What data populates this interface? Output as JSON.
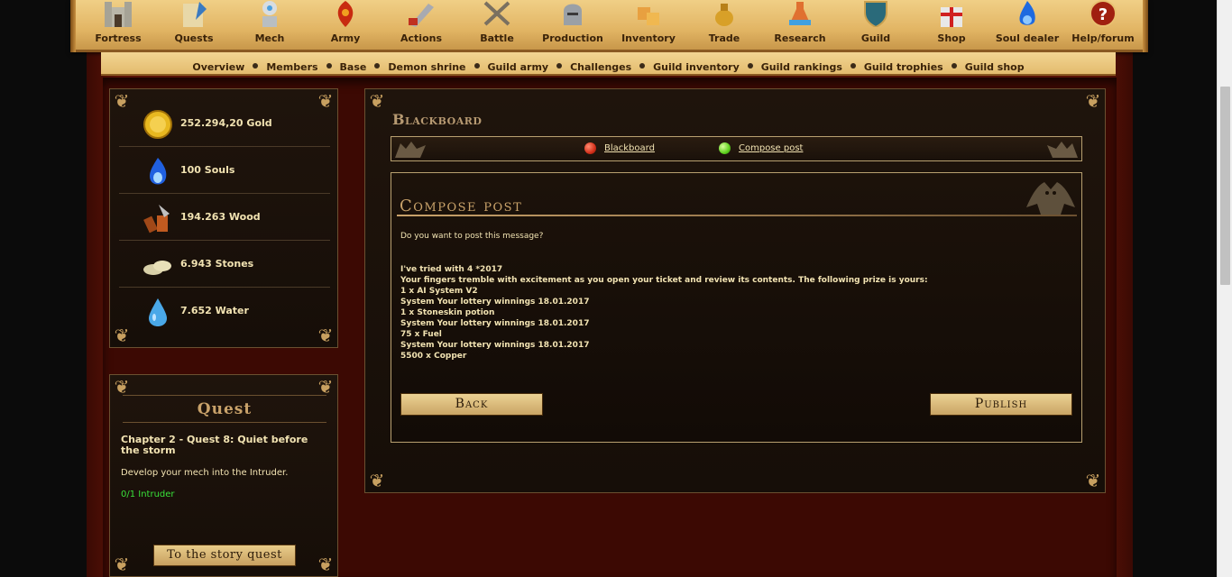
{
  "nav": {
    "items": [
      {
        "label": "Fortress",
        "icon": "fortress-icon"
      },
      {
        "label": "Quests",
        "icon": "quests-icon"
      },
      {
        "label": "Mech",
        "icon": "mech-icon"
      },
      {
        "label": "Army",
        "icon": "army-icon"
      },
      {
        "label": "Actions",
        "icon": "actions-icon"
      },
      {
        "label": "Battle",
        "icon": "battle-icon"
      },
      {
        "label": "Production",
        "icon": "production-icon"
      },
      {
        "label": "Inventory",
        "icon": "inventory-icon"
      },
      {
        "label": "Trade",
        "icon": "trade-icon"
      },
      {
        "label": "Research",
        "icon": "research-icon"
      },
      {
        "label": "Guild",
        "icon": "guild-icon"
      },
      {
        "label": "Shop",
        "icon": "shop-icon"
      },
      {
        "label": "Soul dealer",
        "icon": "soul-dealer-icon"
      },
      {
        "label": "Help/forum",
        "icon": "help-icon"
      }
    ]
  },
  "subnav": {
    "items": [
      "Overview",
      "Members",
      "Base",
      "Demon shrine",
      "Guild army",
      "Challenges",
      "Guild inventory",
      "Guild rankings",
      "Guild trophies",
      "Guild shop"
    ]
  },
  "resources": [
    {
      "label": "252.294,20 Gold",
      "icon": "gold-icon"
    },
    {
      "label": "100 Souls",
      "icon": "souls-icon"
    },
    {
      "label": "194.263 Wood",
      "icon": "wood-icon"
    },
    {
      "label": "6.943 Stones",
      "icon": "stones-icon"
    },
    {
      "label": "7.652 Water",
      "icon": "water-icon"
    }
  ],
  "quest": {
    "title": "Quest",
    "chapter": "Chapter 2 - Quest 8: Quiet before the storm",
    "description": "Develop your mech into the Intruder.",
    "progress": "0/1 Intruder",
    "button": "To the story quest"
  },
  "main": {
    "title": "Blackboard",
    "tabs": [
      {
        "label": "Blackboard",
        "orb_color": "#d3301a"
      },
      {
        "label": "Compose post",
        "orb_color": "#5fd21e"
      }
    ],
    "compose": {
      "title": "Compose post",
      "question": "Do you want to post this message?",
      "message_lines": [
        "I've tried with 4 *2017",
        "Your fingers tremble with excitement as you open your ticket and review its contents. The following prize is yours:",
        "1 x AI System V2",
        "System Your lottery winnings 18.01.2017",
        "1 x Stoneskin potion",
        "System Your lottery winnings 18.01.2017",
        "75 x Fuel",
        "System Your lottery winnings 18.01.2017",
        "5500 x Copper"
      ],
      "back_label": "Back",
      "publish_label": "Publish"
    }
  },
  "colors": {
    "nav_gold": "#e2b564",
    "panel_dark": "#1f140c",
    "text_cream": "#f2e3b2",
    "progress_green": "#39e03a",
    "frame_red": "#4a0e05"
  }
}
